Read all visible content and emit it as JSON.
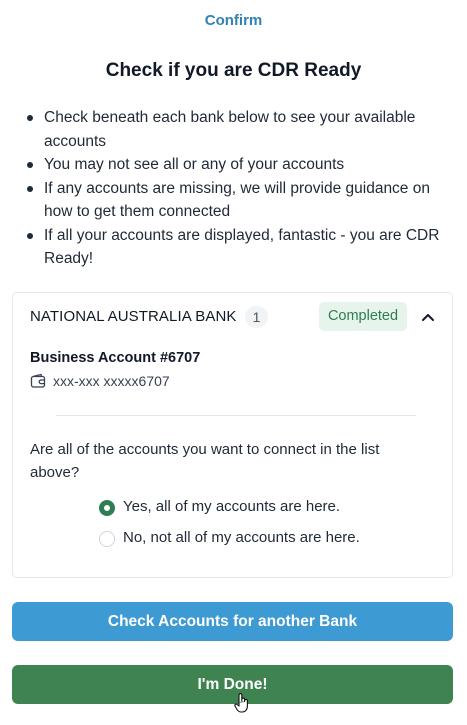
{
  "header": {
    "confirm_link": "Confirm",
    "title": "Check if you are CDR Ready"
  },
  "instructions": [
    "Check beneath each bank below to see your available accounts",
    "You may not see all or any of your accounts",
    "If any accounts are missing, we will provide guidance on how to get them connected",
    "If all your accounts are displayed, fantastic - you are CDR Ready!"
  ],
  "bank": {
    "name": "NATIONAL AUSTRALIA BANK",
    "account_count": "1",
    "status": "Completed",
    "status_color": "#2f7d4f",
    "chevron_icon": "chevron-up-icon",
    "accounts": [
      {
        "name": "Business Account #6707",
        "number": "xxx-xxx xxxxx6707",
        "icon": "wallet-icon"
      }
    ],
    "question": "Are all of the accounts you want to connect in the list above?",
    "options": [
      {
        "label": "Yes, all of my accounts are here.",
        "selected": true
      },
      {
        "label": "No, not all of my accounts are here.",
        "selected": false
      }
    ]
  },
  "actions": {
    "another_bank_label": "Check Accounts for another Bank",
    "another_bank_color": "#3d9ad3",
    "done_label": "I'm Done!",
    "done_color": "#3f8450"
  },
  "pointer_icon": "hand-pointer-icon"
}
